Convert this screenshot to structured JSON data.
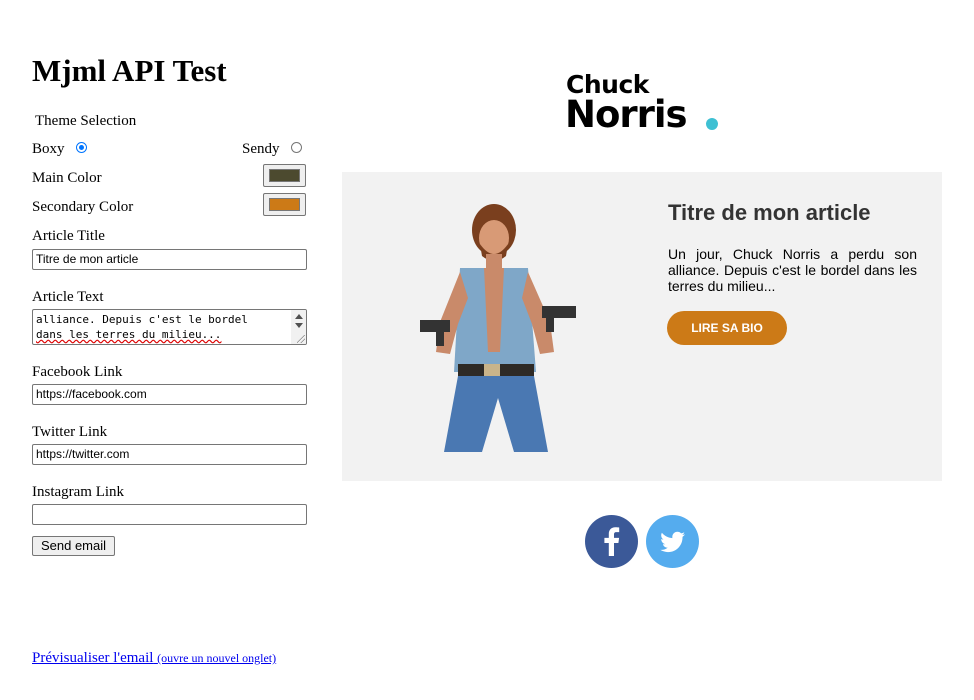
{
  "page_title": "Mjml API Test",
  "theme": {
    "label": "Theme Selection",
    "options": [
      {
        "label": "Boxy",
        "selected": true
      },
      {
        "label": "Sendy",
        "selected": false
      }
    ]
  },
  "main_color": {
    "label": "Main Color",
    "value": "#4c4a2f"
  },
  "secondary_color": {
    "label": "Secondary Color",
    "value": "#cc7a17"
  },
  "article_title": {
    "label": "Article Title",
    "value": "Titre de mon article"
  },
  "article_text": {
    "label": "Article Text",
    "visible_lines": [
      "alliance. Depuis c'est le bordel",
      "dans les terres du milieu..."
    ]
  },
  "facebook_link": {
    "label": "Facebook Link",
    "value": "https://facebook.com"
  },
  "twitter_link": {
    "label": "Twitter Link",
    "value": "https://twitter.com"
  },
  "instagram_link": {
    "label": "Instagram Link",
    "value": ""
  },
  "send_button": "Send email",
  "preview_link": {
    "text": "Prévisualiser l'email",
    "note": "(ouvre un nouvel onglet)"
  },
  "email": {
    "logo_line1": "Chuck",
    "logo_line2": "Norris",
    "logo_dot_color": "#3ec0d3",
    "hero_bg": "#f2f2f2",
    "article_title": "Titre de mon article",
    "article_text": "Un jour, Chuck Norris a perdu son alliance. Depuis c'est le bordel dans les terres du milieu...",
    "cta_label": "LIRE SA BIO",
    "cta_color": "#cc7a17",
    "social": [
      {
        "icon": "facebook-icon",
        "color": "#3b5998"
      },
      {
        "icon": "twitter-icon",
        "color": "#55acee"
      }
    ]
  }
}
